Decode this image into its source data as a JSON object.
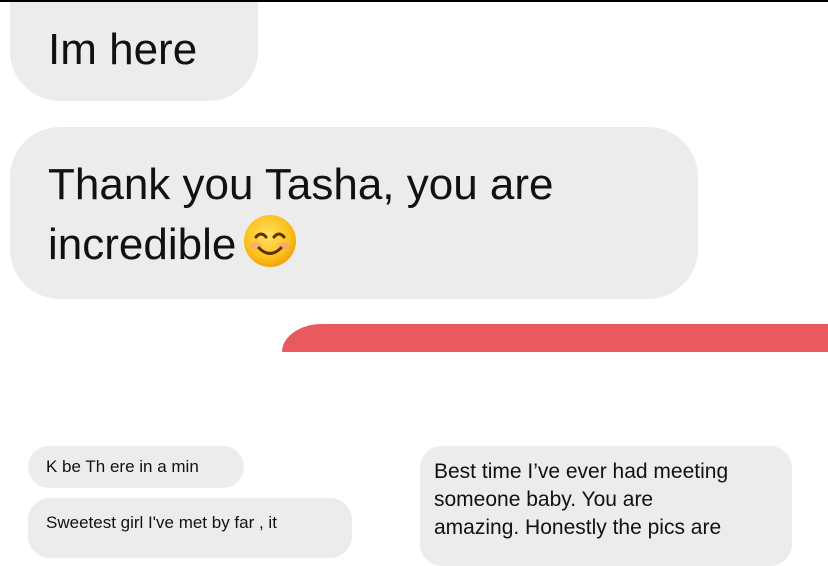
{
  "messages": {
    "top_bubble": "Im here",
    "second_bubble": {
      "line1": "Thank you Tasha, you are",
      "line2": "incredible"
    },
    "emoji": "smiling-face-with-smiling-eyes",
    "left_small_1": "K be Th ere in a min",
    "left_small_2": "Sweetest girl I've met by far , it",
    "right_small": {
      "line1": "Best time I’ve ever had meeting",
      "line2": "someone baby. You are",
      "line3": "amazing. Honestly the pics are"
    }
  },
  "colors": {
    "bubble_gray": "#ececed",
    "red_bar": "#e85a5d",
    "text": "#111111"
  }
}
